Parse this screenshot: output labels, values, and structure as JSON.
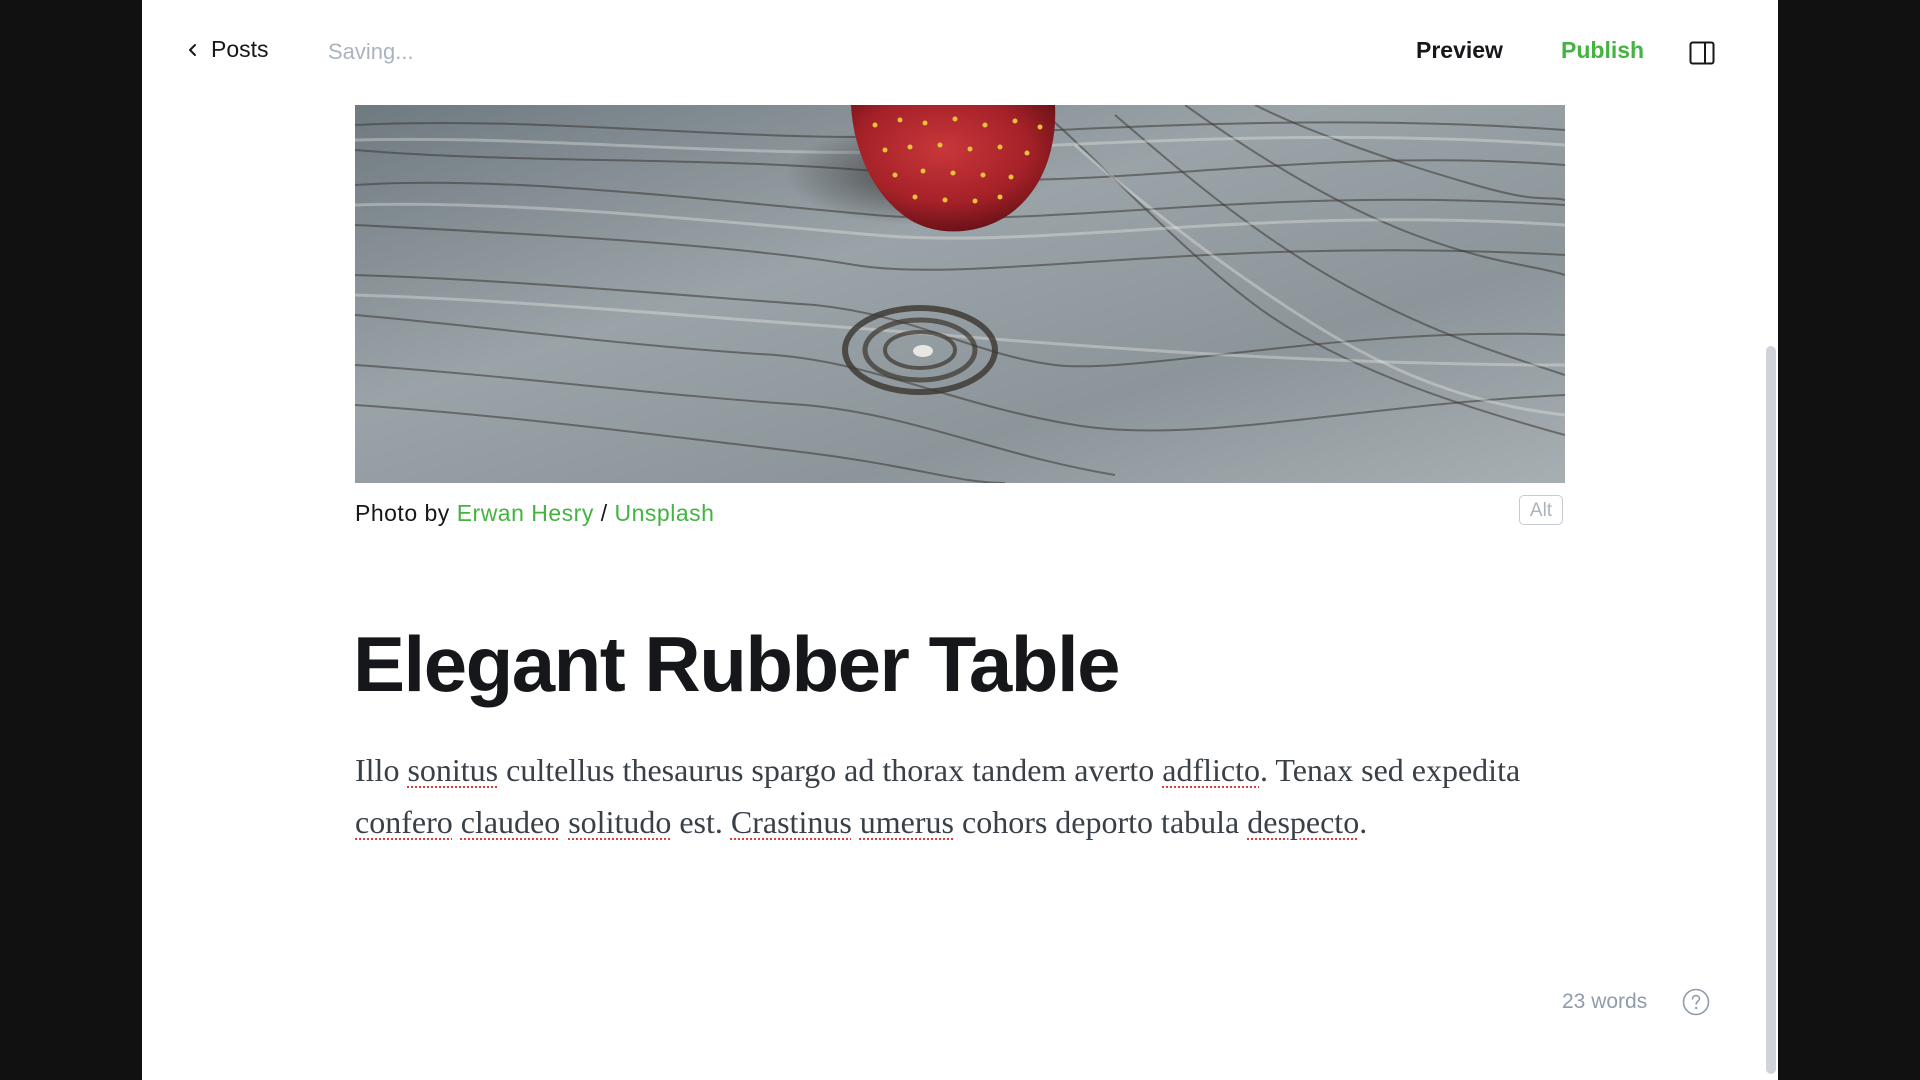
{
  "topbar": {
    "back_label": "Posts",
    "status": "Saving...",
    "preview_label": "Preview",
    "publish_label": "Publish"
  },
  "feature_image": {
    "caption_prefix": "Photo by ",
    "author": "Erwan Hesry",
    "separator": " / ",
    "source": "Unsplash",
    "alt_button": "Alt"
  },
  "post": {
    "title": "Elegant Rubber Table",
    "body_segments": [
      {
        "text": "Illo ",
        "misspelled": false
      },
      {
        "text": "sonitus",
        "misspelled": true
      },
      {
        "text": " cultellus thesaurus spargo ad thorax tandem averto ",
        "misspelled": false
      },
      {
        "text": "adflicto",
        "misspelled": true
      },
      {
        "text": ". Tenax sed expedita ",
        "misspelled": false
      },
      {
        "text": "confero",
        "misspelled": true
      },
      {
        "text": " ",
        "misspelled": false
      },
      {
        "text": "claudeo",
        "misspelled": true
      },
      {
        "text": " ",
        "misspelled": false
      },
      {
        "text": "solitudo",
        "misspelled": true
      },
      {
        "text": " est. ",
        "misspelled": false
      },
      {
        "text": "Crastinus",
        "misspelled": true
      },
      {
        "text": " ",
        "misspelled": false
      },
      {
        "text": "umerus",
        "misspelled": true
      },
      {
        "text": " cohors deporto tabula ",
        "misspelled": false
      },
      {
        "text": "despecto",
        "misspelled": true
      },
      {
        "text": ".",
        "misspelled": false
      }
    ]
  },
  "footer": {
    "word_count": "23 words"
  },
  "colors": {
    "accent": "#44b341",
    "text": "#15171a",
    "muted": "#abb4be",
    "spellcheck": "#e23b3b"
  },
  "icons": {
    "back": "chevron-left-icon",
    "sidebar": "sidebar-toggle-icon",
    "help": "question-circle-icon"
  }
}
